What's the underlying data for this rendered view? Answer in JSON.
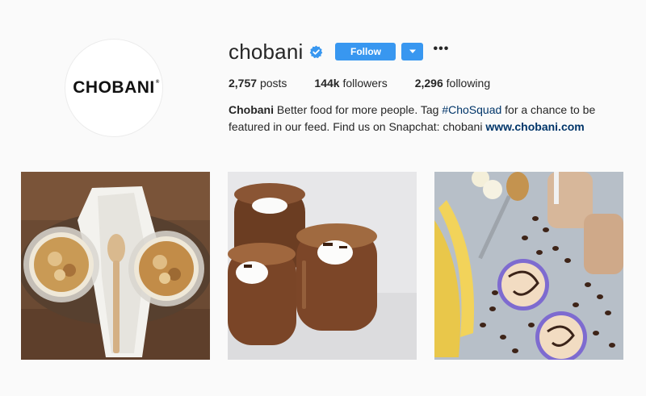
{
  "profile": {
    "logo_text": "CHOBANI",
    "username": "chobani",
    "verified_icon": "verified-badge-icon",
    "follow_label": "Follow",
    "dropdown_icon": "caret-down-icon",
    "more_label": "•••"
  },
  "stats": {
    "posts_count": "2,757",
    "posts_label": "posts",
    "followers_count": "144k",
    "followers_label": "followers",
    "following_count": "2,296",
    "following_label": "following"
  },
  "bio": {
    "name": "Chobani",
    "text1": " Better food for more people. Tag ",
    "hashtag": "#ChoSquad",
    "text2": " for a chance to be featured in our feed. Find us on Snapchat: chobani ",
    "link": "www.chobani.com"
  },
  "posts": [
    {
      "alt_icon": "yogurt-cups-spoon-photo"
    },
    {
      "alt_icon": "chocolate-pudding-jars-photo"
    },
    {
      "alt_icon": "banana-coffee-drinks-photo"
    }
  ],
  "colors": {
    "accent": "#3897f0",
    "background": "#fafafa",
    "link": "#003569"
  }
}
